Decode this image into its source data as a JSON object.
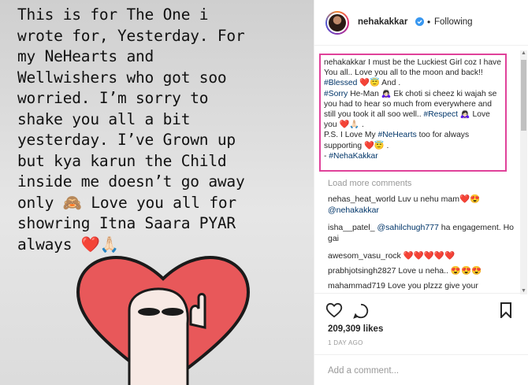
{
  "post_image": {
    "story_text": "This is for The One i\nwrote for, Yesterday. For\nmy NeHearts and\nWellwishers who got soo\nworried. I’m sorry to\nshake you all a bit\nyesterday. I’ve Grown up\nbut kya karun the Child\ninside me doesn’t go away\nonly 🙈 Love you all for\nshowring Itna Saara PYAR\nalways ❤️🙏🏻"
  },
  "header": {
    "username": "nehakakkar",
    "separator": "•",
    "follow_status": "Following"
  },
  "caption": {
    "username": "nehakakkar",
    "p1": " I must be the Luckiest Girl coz I have You all.. Love you all to the moon and back!! ",
    "tag_blessed": "#Blessed",
    "p2": " ❤️😇 And .",
    "tag_sorry": "#Sorry",
    "p3": " He-Man 🙇🏻‍♀️ Ek choti si cheez ki wajah se you had to hear so much from everywhere and still you took it all soo well.. ",
    "tag_respect": "#Respect",
    "p4": " 🙇🏻‍♀️ Love you ❤️🙏🏻 .",
    "p5": "P.S. I Love My ",
    "tag_nehearts": "#NeHearts",
    "p6": " too for always supporting ❤️😇 .",
    "p7": "- ",
    "tag_nehakakkar": "#NehaKakkar"
  },
  "load_more": "Load more comments",
  "comments": [
    {
      "user": "nehas_heat_world",
      "text": " Luv u nehu mam❤️😍",
      "mention": "@nehakakkar",
      "after": ""
    },
    {
      "user": "isha__patel_",
      "text": " ",
      "mention": "@sahilchugh777",
      "after": " ha engagement. Ho gai"
    },
    {
      "user": "awesom_vasu_rock",
      "text": " ❤️❤️❤️❤️❤️",
      "mention": "",
      "after": ""
    },
    {
      "user": "prabhjotsingh2827",
      "text": " Love u neha.. 😍😍😍",
      "mention": "",
      "after": ""
    },
    {
      "user": "mahammad719",
      "text": " Love you plzzz give your",
      "mention": "",
      "after": ""
    }
  ],
  "likes": "209,309 likes",
  "time_ago": "1 DAY AGO",
  "add_comment_placeholder": "Add a comment...",
  "colors": {
    "highlight_border": "#e0429a",
    "hashtag": "#003569",
    "verified": "#3897f0"
  }
}
